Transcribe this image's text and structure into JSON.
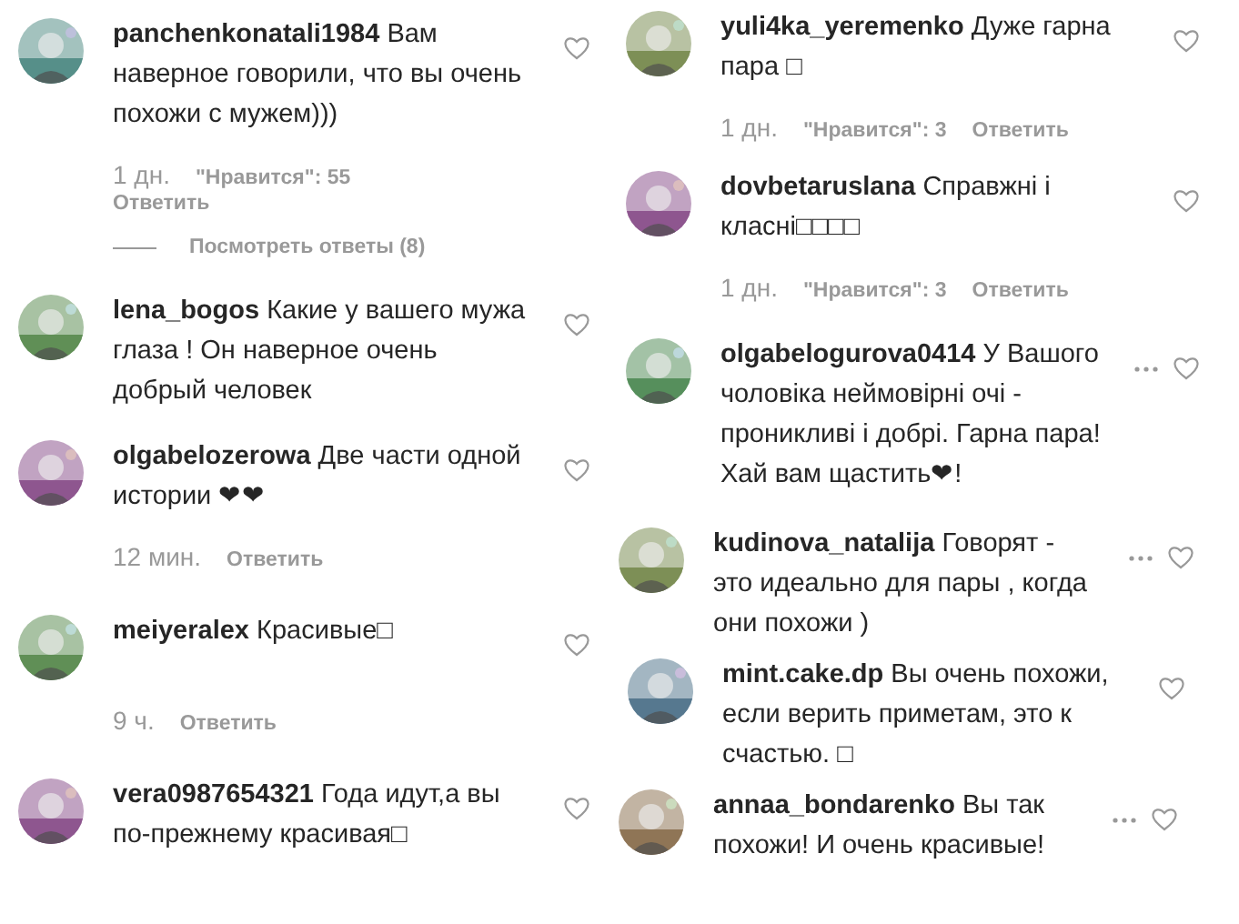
{
  "columns": [
    {
      "comments": [
        {
          "user": "panchenkonatali1984",
          "text": "Вам наверное говорили, что вы очень похожи с мужем)))",
          "time": "1 дн.",
          "likes": "\"Нравится\": 55",
          "reply": "Ответить",
          "replies": "Посмотреть ответы (8)"
        },
        {
          "user": "lena_bogos",
          "text": "Какие у вашего мужа глаза ! Он наверное очень добрый человек"
        },
        {
          "user": "olgabelozerowa",
          "text": "Две части одной истории ❤❤",
          "time": "12 мин.",
          "reply": "Ответить"
        },
        {
          "user": "meiyeralex",
          "text": "Красивые□",
          "time": "9 ч.",
          "reply": "Ответить"
        },
        {
          "user": "vera0987654321",
          "text": "Года идут,а вы по-прежнему красивая□"
        }
      ]
    },
    {
      "comments": [
        {
          "user": "yuli4ka_yeremenko",
          "text": "Дуже гарна пара □",
          "time": "1 дн.",
          "likes": "\"Нравится\": 3",
          "reply": "Ответить"
        },
        {
          "user": "dovbetaruslana",
          "text": "Справжні і класні□□□□",
          "time": "1 дн.",
          "likes": "\"Нравится\": 3",
          "reply": "Ответить"
        },
        {
          "user": "olgabelogurova0414",
          "text": "У Вашого чоловіка неймовірні очі - проникливі і добрі. Гарна пара! Хай вам щастить❤!",
          "more": true
        },
        {
          "user": "kudinova_natalija",
          "text": "Говорят - это идеально для пары , когда они похожи )",
          "more": true
        },
        {
          "user": "mint.cake.dp",
          "text": "Вы очень похожи, если верить приметам, это к счастью. □"
        },
        {
          "user": "annaa_bondarenko",
          "text": "Вы так похожи! И очень красивые!",
          "more": true
        }
      ]
    }
  ]
}
